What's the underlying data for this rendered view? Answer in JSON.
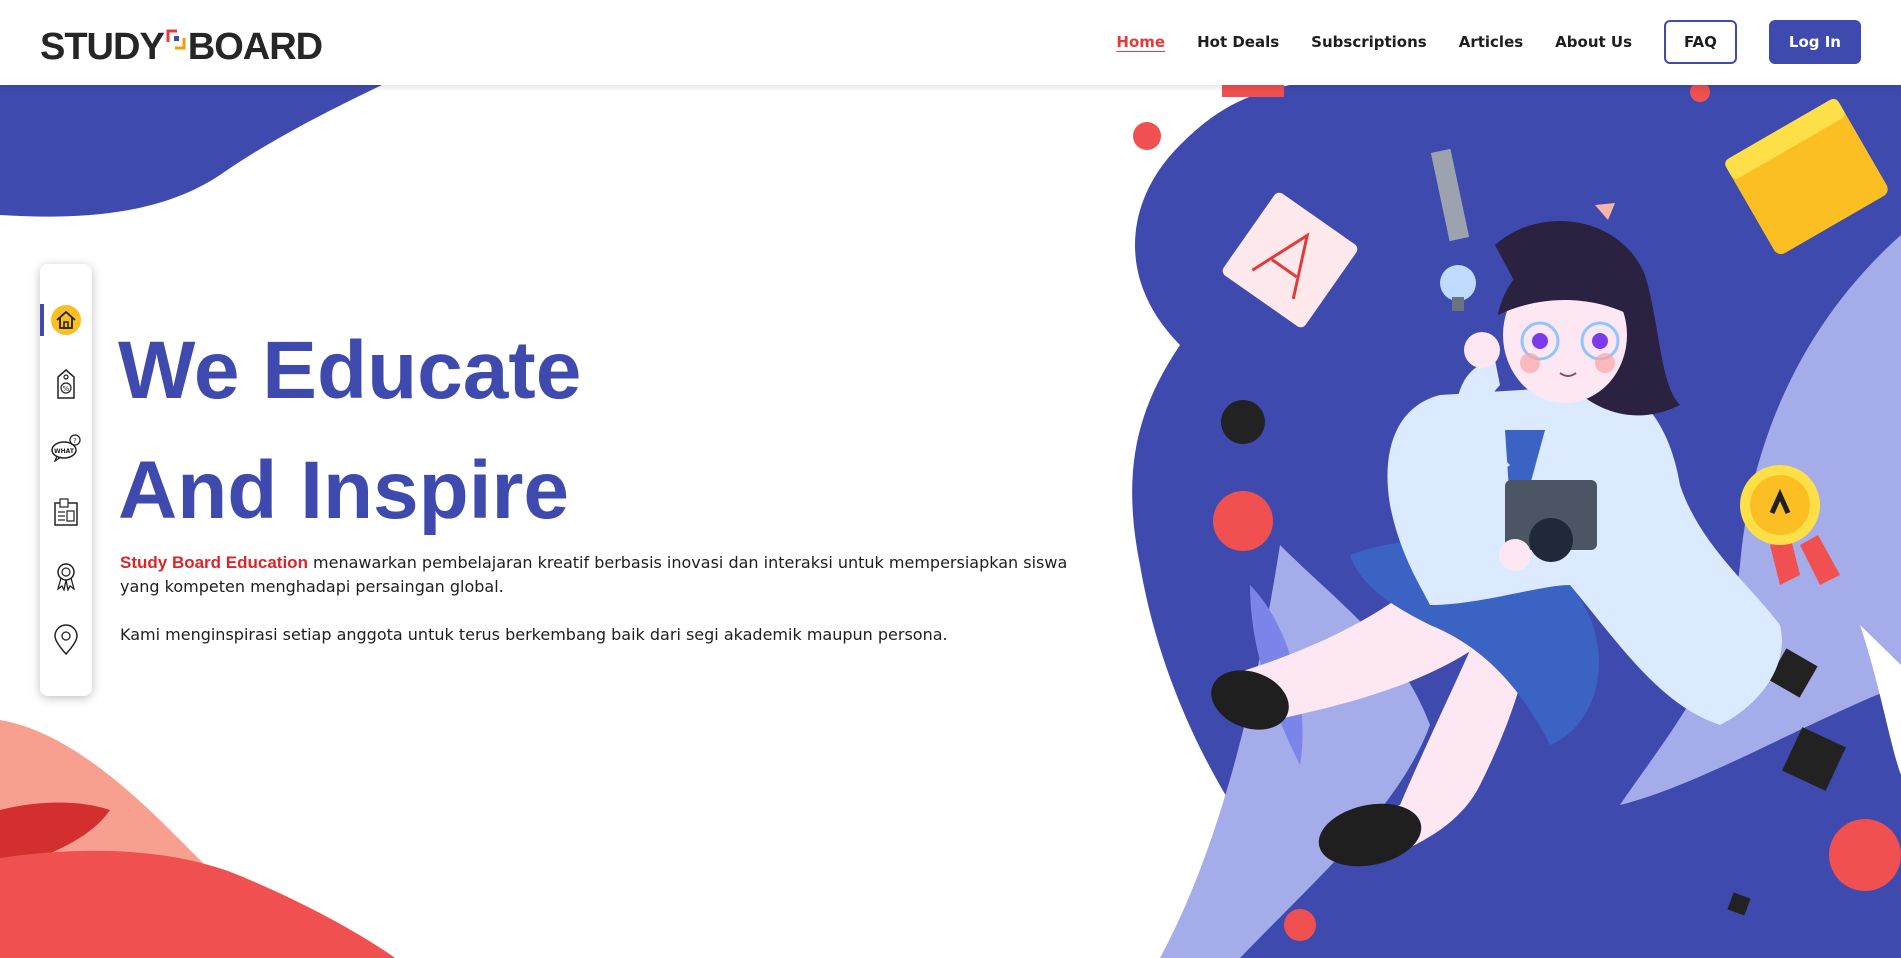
{
  "header": {
    "logo_left": "STUDY",
    "logo_right": "BOARD",
    "nav": [
      {
        "label": "Home",
        "active": true
      },
      {
        "label": "Hot Deals",
        "active": false
      },
      {
        "label": "Subscriptions",
        "active": false
      },
      {
        "label": "Articles",
        "active": false
      },
      {
        "label": "About Us",
        "active": false
      }
    ],
    "faq_label": "FAQ",
    "login_label": "Log In"
  },
  "sidebar": {
    "items": [
      {
        "icon": "home-icon",
        "active": true
      },
      {
        "icon": "price-tag-icon",
        "active": false
      },
      {
        "icon": "what-speech-bubble-icon",
        "active": false
      },
      {
        "icon": "article-newspaper-icon",
        "active": false
      },
      {
        "icon": "award-ribbon-icon",
        "active": false
      },
      {
        "icon": "location-pin-icon",
        "active": false
      }
    ]
  },
  "hero": {
    "title_line1": "We Educate",
    "title_line2": "And Inspire",
    "brand": "Study Board Education",
    "paragraph1_rest": " menawarkan pembelajaran kreatif berbasis inovasi dan interaksi untuk mempersiapkan siswa yang kompeten menghadapi persaingan global.",
    "paragraph2": "Kami menginspirasi setiap anggota untuk terus berkembang baik dari segi akademik maupun persona."
  },
  "colors": {
    "primary": "#3f4aae",
    "accent_red": "#e23b3b",
    "brand_red": "#d9262b",
    "coral": "#f0504f",
    "salmon": "#f8a08f",
    "yellow": "#fbbf24"
  }
}
